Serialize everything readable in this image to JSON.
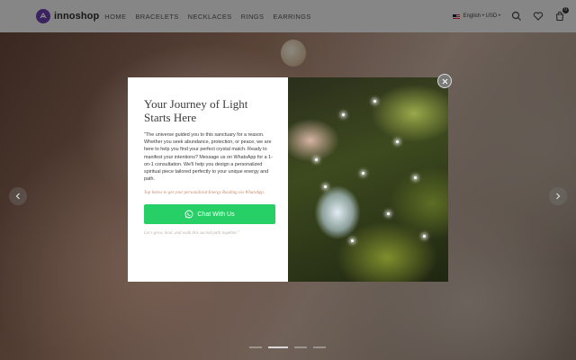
{
  "brand": {
    "name": "innoshop",
    "color": "#6b3fb0"
  },
  "nav": {
    "items": [
      "HOME",
      "BRACELETS",
      "NECKLACES",
      "RINGS",
      "EARRINGS"
    ]
  },
  "header": {
    "locale": "English • USD •",
    "cart_count": "0"
  },
  "modal": {
    "title": "Your Journey of Light Starts Here",
    "body": "\"The universe guided you to this sanctuary for a reason. Whether you seek abundance, protection, or peace, we are here to help you find your perfect crystal match. Ready to manifest your intentions? Message us on WhatsApp for a 1-on-1 consultation. We'll help you design a personalized spiritual piece tailored perfectly to your unique energy and path.",
    "tip": "Tap below to get your personalized Energy Reading via WhatsApp.",
    "cta_label": "Chat With Us",
    "closing": "Let's grow, heal, and walk this sacred path together.\"",
    "cta_color": "#27d066"
  },
  "carousel": {
    "active_index": 1,
    "slide_count": 4
  },
  "icons": [
    "search-icon",
    "heart-icon",
    "cart-icon",
    "close-icon",
    "whatsapp-icon",
    "chevron-left-icon",
    "chevron-right-icon"
  ]
}
